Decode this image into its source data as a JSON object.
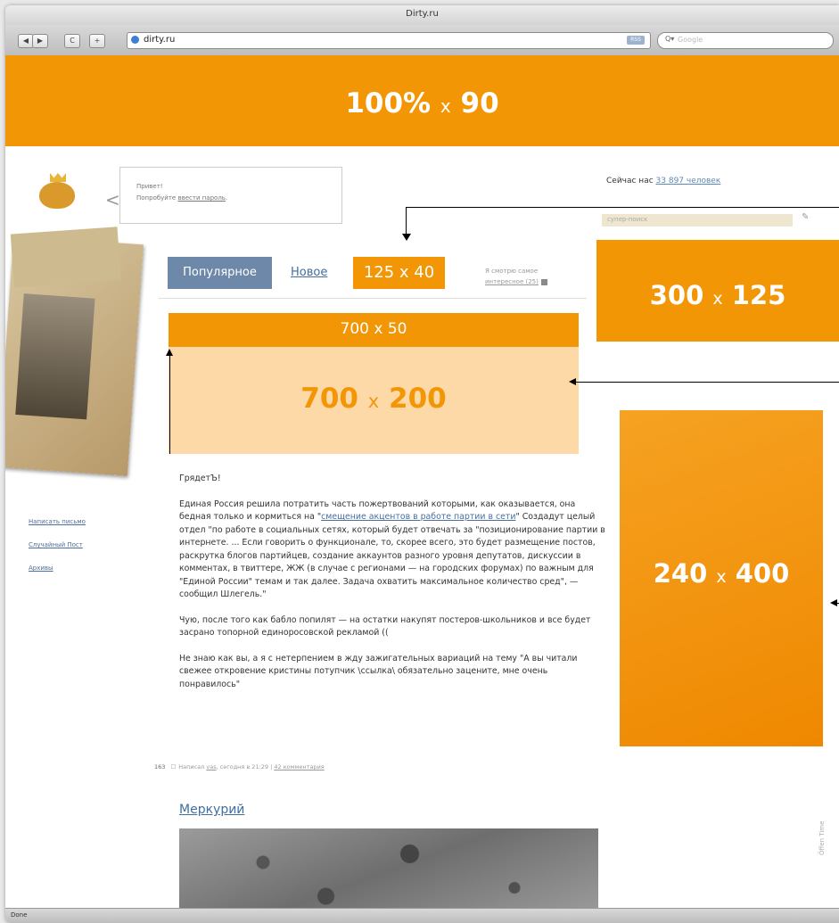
{
  "browser": {
    "window_title": "Dirty.ru",
    "url": "dirty.ru",
    "rss_badge": "RSS",
    "search_placeholder": "Google",
    "search_icon_label": "Q▾",
    "status": "Done",
    "buttons": {
      "back": "◀",
      "forward": "▶",
      "reload": "C",
      "add": "+"
    }
  },
  "ads": {
    "top_banner": {
      "num_a": "100%",
      "x": "x",
      "num_b": "90"
    },
    "tab_ad": "125 x 40",
    "right_square": {
      "num_a": "300",
      "x": "x",
      "num_b": "125"
    },
    "strip": "700 x 50",
    "big": {
      "num_a": "700",
      "x": "x",
      "num_b": "200"
    },
    "skyscraper": {
      "num_a": "240",
      "x": "x",
      "num_b": "400"
    }
  },
  "greeting": {
    "line1": "Привет!",
    "line2_prefix": "Попробуйте ",
    "line2_link": "ввести пароль",
    "line2_suffix": "."
  },
  "online": {
    "prefix": "Сейчас нас ",
    "link": "33 897 человек"
  },
  "site_search": {
    "placeholder": "супер-поиск"
  },
  "sidebar": {
    "links": [
      "Написать письмо",
      "Случайный Пост",
      "Архивы"
    ]
  },
  "tabs": {
    "popular": "Популярное",
    "new": "Новое"
  },
  "interesting": {
    "line1": "Я смотрю самое",
    "link": "интересное (25)"
  },
  "post": {
    "p1": "ГрядетЪ!",
    "p2_a": "Единая Россия решила потратить часть пожертвований которыми, как оказывается, она бедная только и кормиться на \"",
    "p2_link": "смещение акцентов в работе партии в сети",
    "p2_b": "\" Создадут целый отдел \"по работе в социальных сетях, который будет отвечать за \"позиционирование партии в интернете. ... Если говорить о функционале, то, скорее всего, это будет размещение постов, раскрутка блогов партийцев, создание аккаунтов разного уровня депутатов, дискуссии в комментах, в твиттере, ЖЖ (в случае с регионами — на городских форумах) по важным для \"Единой России\" темам и так далее. Задача охватить максимальное количество сред\", — сообщил Шлегель.\"",
    "p3": "Чую, после того как бабло попилят — на остатки накупят постеров-школьников и все будет засрано топорной единоросовской рекламой ((",
    "p4": "Не знаю как вы, а я с нетерпением в жду зажигательных вариаций на тему \"А вы читали свежее откровение кристины потупчик \\ссылка\\ обязательно зацените, мне очень понравилось\"",
    "rating": "163",
    "meta_prefix": "Написал ",
    "meta_author": "vas",
    "meta_mid": ", сегодня в 21:29 | ",
    "meta_comments": "42 комментария"
  },
  "next_post": {
    "title": "Меркурий"
  },
  "watermark": "Öffen Time",
  "colors": {
    "accent_orange": "#f39606",
    "light_orange": "#fcd9a7",
    "tab_blue": "#6d88a8",
    "link_blue": "#4b6f9e"
  }
}
